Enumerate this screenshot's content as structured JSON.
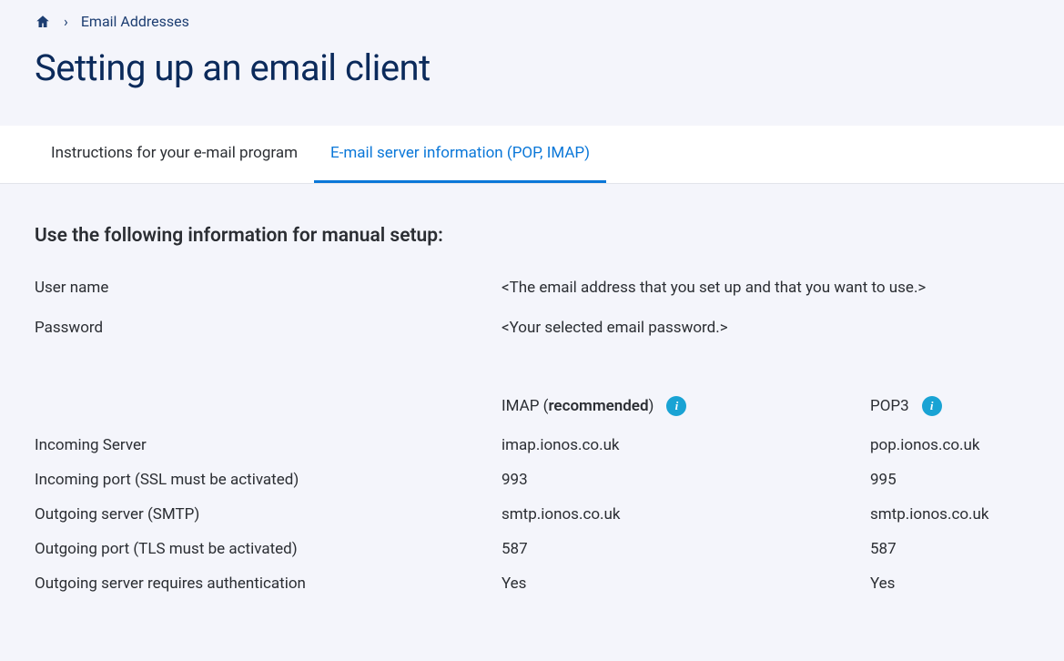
{
  "breadcrumb": {
    "link": "Email Addresses"
  },
  "page_title": "Setting up an email client",
  "tabs": {
    "instructions": "Instructions for your e-mail program",
    "server_info": "E-mail server information (POP, IMAP)"
  },
  "section_heading": "Use the following information for manual setup:",
  "credentials": {
    "username_label": "User name",
    "username_value": "<The email address that you set up and that you want to use.>",
    "password_label": "Password",
    "password_value": "<Your selected email password.>"
  },
  "server_headers": {
    "imap_prefix": "IMAP (",
    "imap_bold": "recommended",
    "imap_suffix": ")",
    "pop": "POP3"
  },
  "server_rows": {
    "incoming_server": {
      "label": "Incoming Server",
      "imap": "imap.ionos.co.uk",
      "pop": "pop.ionos.co.uk"
    },
    "incoming_port": {
      "label": "Incoming port (SSL must be activated)",
      "imap": "993",
      "pop": "995"
    },
    "outgoing_server": {
      "label": "Outgoing server (SMTP)",
      "imap": "smtp.ionos.co.uk",
      "pop": "smtp.ionos.co.uk"
    },
    "outgoing_port": {
      "label": "Outgoing port (TLS must be activated)",
      "imap": "587",
      "pop": "587"
    },
    "outgoing_auth": {
      "label": "Outgoing server requires authentication",
      "imap": "Yes",
      "pop": "Yes"
    }
  }
}
